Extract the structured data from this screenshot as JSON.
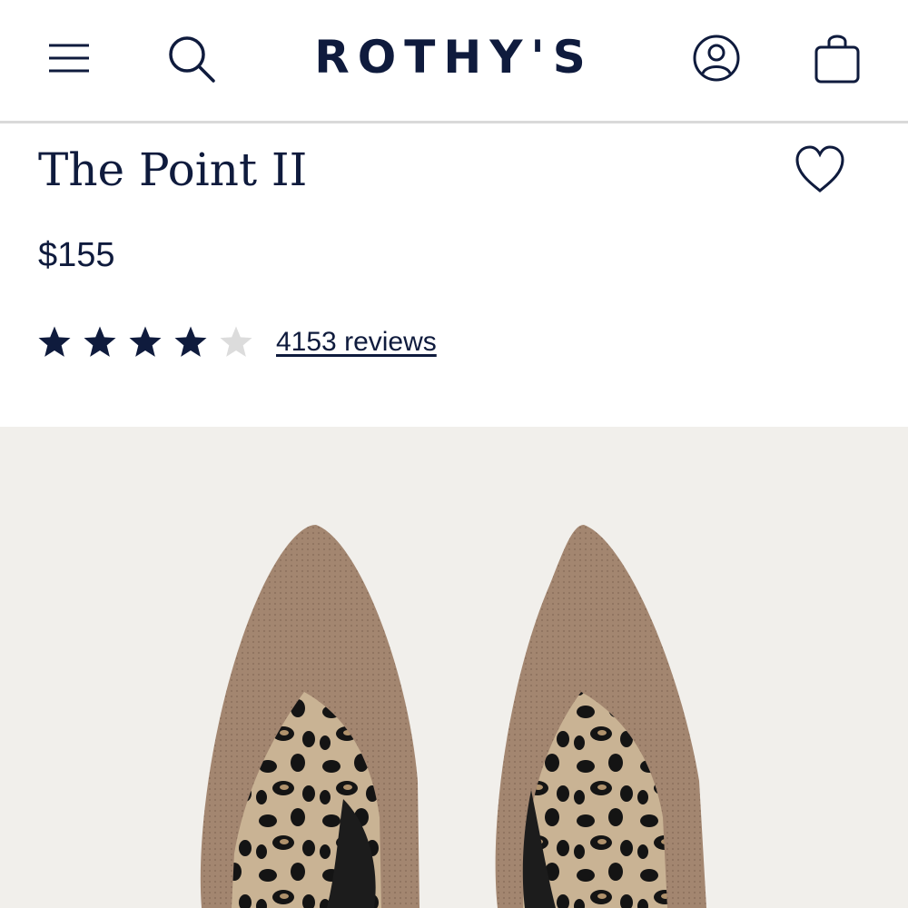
{
  "header": {
    "logo": "ROTHY'S",
    "menu_icon": "hamburger-menu-icon",
    "search_icon": "search-icon",
    "account_icon": "account-icon",
    "cart_icon": "shopping-bag-icon"
  },
  "product": {
    "title": "The Point II",
    "price": "$155",
    "rating": {
      "value": 4,
      "max": 5
    },
    "reviews_label": "4153 reviews",
    "wishlist_icon": "heart-icon"
  },
  "gallery": {
    "image": "pointed-toe-flats-image"
  },
  "colors": {
    "navy": "#0f1b3d",
    "star_empty": "#dcdcdc",
    "gallery_bg": "#f1efeb",
    "shoe_taupe": "#a38670"
  }
}
